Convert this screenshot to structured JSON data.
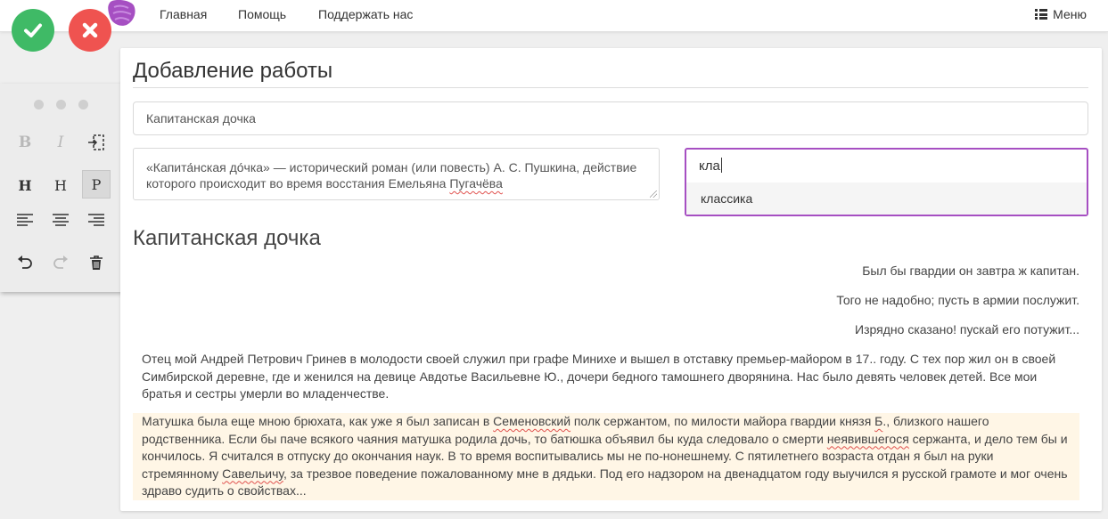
{
  "nav": {
    "links": [
      "Главная",
      "Помощь",
      "Поддержать нас"
    ],
    "menu_label": "Меню"
  },
  "colors": {
    "ok": "#3fba66",
    "cancel": "#ef5350",
    "logo": "#a64fc2",
    "focus_border": "#a64fc2",
    "highlight": "#fff6e6"
  },
  "toolbar": {
    "buttons": [
      "bold-icon",
      "italic-icon",
      "insert-break-icon",
      "heading-large-icon",
      "heading-small-icon",
      "paragraph-icon",
      "align-left-icon",
      "align-center-icon",
      "align-right-icon",
      "undo-icon",
      "redo-icon",
      "trash-icon"
    ],
    "bold": "B",
    "italic": "I",
    "h1": "H",
    "h2": "H",
    "paragraph": "P"
  },
  "form": {
    "page_title": "Добавление работы",
    "title_value": "Капитанская дочка",
    "description_before": "«Капита́нская до́чка» — исторический роман (или повесть) А. С. Пушкина, действие которого происходит во время восстания Емельяна ",
    "description_misspelled": "Пугачёва",
    "tag_query": "кла",
    "tag_suggestion": "классика"
  },
  "content": {
    "title": "Капитанская дочка",
    "epigraph": [
      "Был бы гвардии он завтра ж капитан.",
      "Того не надобно; пусть в армии послужит.",
      "Изрядно сказано! пускай его потужит..."
    ],
    "paragraph1": "Отец мой Андрей Петрович Гринев в молодости своей служил при графе Минихе и вышел в отставку премьер-майором в 17.. году. С тех пор жил он в своей Симбирской деревне, где и женился на девице Авдотье Васильевне Ю., дочери бедного тамошнего дворянина. Нас было девять человек детей. Все мои братья и сестры умерли во младенчестве.",
    "paragraph2": {
      "s1": "Матушка была еще мною брюхата, как уже я был записан в ",
      "w1": "Семеновский",
      "s2": " полк сержантом, по милости майора гвардии князя ",
      "w2": "Б",
      "s3": "., близкого нашего родственника. Если бы паче всякого чаяния матушка родила дочь, то батюшка объявил бы куда следовало о смерти ",
      "w3": "неявившегося",
      "s4": " сержанта, и дело тем бы и кончилось. Я считался в отпуску до окончания наук. В то время воспитывались мы не по-нонешнему. С пятилетнего возраста отдан я был на руки стремянному ",
      "w4": "Савельичу",
      "s5": ", за трезвое поведение пожалованному мне в дядьки. Под его надзором на двенадцатом году выучился я русской грамоте и мог очень здраво судить о свойствах..."
    }
  }
}
